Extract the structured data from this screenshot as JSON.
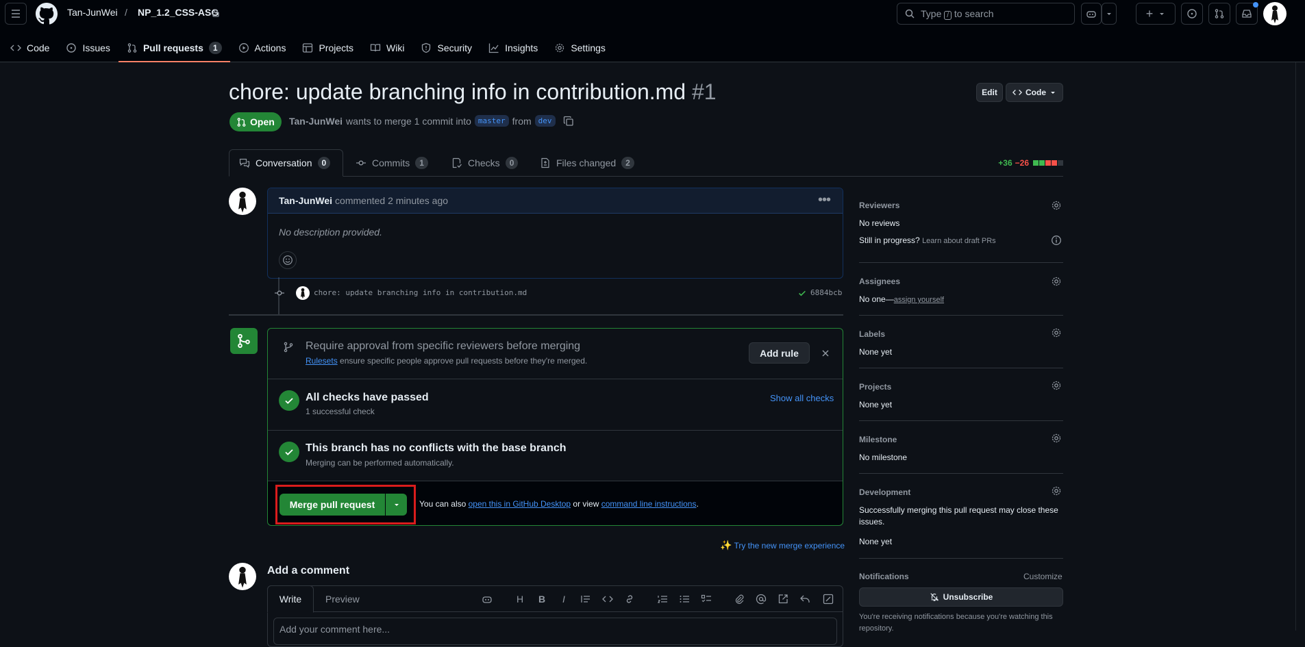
{
  "header": {
    "owner": "Tan-JunWei",
    "separator": "/",
    "repo": "NP_1.2_CSS-ASG",
    "search_prefix": "Type",
    "search_key": "/",
    "search_suffix": "to search"
  },
  "nav": {
    "code": "Code",
    "issues": "Issues",
    "pulls": "Pull requests",
    "pulls_count": "1",
    "actions": "Actions",
    "projects": "Projects",
    "wiki": "Wiki",
    "security": "Security",
    "insights": "Insights",
    "settings": "Settings"
  },
  "pr": {
    "title": "chore: update branching info in contribution.md",
    "number": "#1",
    "edit": "Edit",
    "code_btn": "Code",
    "state": "Open",
    "author": "Tan-JunWei",
    "meta_mid": "wants to merge 1 commit into",
    "base": "master",
    "from": "from",
    "head": "dev"
  },
  "tabs": {
    "conversation": "Conversation",
    "conversation_count": "0",
    "commits": "Commits",
    "commits_count": "1",
    "checks": "Checks",
    "checks_count": "0",
    "files": "Files changed",
    "files_count": "2",
    "additions": "+36",
    "deletions": "−26"
  },
  "comment": {
    "author": "Tan-JunWei",
    "action": "commented 2 minutes ago",
    "body": "No description provided."
  },
  "commit": {
    "message": "chore: update branching info in contribution.md",
    "sha": "6884bcb"
  },
  "merge": {
    "rule_title": "Require approval from specific reviewers before merging",
    "rule_link": "Rulesets",
    "rule_desc": "ensure specific people approve pull requests before they're merged.",
    "add_rule": "Add rule",
    "checks_title": "All checks have passed",
    "checks_sub": "1 successful check",
    "show_checks": "Show all checks",
    "conflicts_title": "This branch has no conflicts with the base branch",
    "conflicts_sub": "Merging can be performed automatically.",
    "merge_btn": "Merge pull request",
    "also": "You can also",
    "desktop_link": "open this in GitHub Desktop",
    "or_view": "or view",
    "cli_link": "command line instructions",
    "period": ".",
    "try_new": "Try the new merge experience"
  },
  "add_comment": {
    "title": "Add a comment",
    "write": "Write",
    "preview": "Preview",
    "placeholder": "Add your comment here..."
  },
  "sidebar": {
    "reviewers": "Reviewers",
    "no_reviews": "No reviews",
    "in_progress": "Still in progress?",
    "draft_link": "Learn about draft PRs",
    "assignees": "Assignees",
    "no_one": "No one—",
    "assign_self": "assign yourself",
    "labels": "Labels",
    "labels_val": "None yet",
    "projects": "Projects",
    "projects_val": "None yet",
    "milestone": "Milestone",
    "milestone_val": "No milestone",
    "development": "Development",
    "dev_desc": "Successfully merging this pull request may close these issues.",
    "dev_val": "None yet",
    "notifications": "Notifications",
    "customize": "Customize",
    "unsubscribe": "Unsubscribe",
    "notif_reason": "You're receiving notifications because you're watching this repository."
  }
}
